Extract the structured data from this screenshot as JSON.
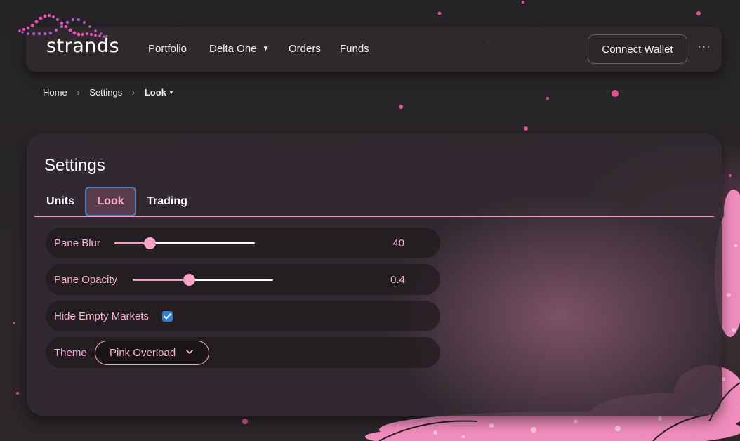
{
  "brand": {
    "name": "strands"
  },
  "nav": {
    "items": [
      {
        "label": "Portfolio",
        "dropdown": false
      },
      {
        "label": "Delta One",
        "dropdown": true
      },
      {
        "label": "Orders",
        "dropdown": false
      },
      {
        "label": "Funds",
        "dropdown": false
      }
    ],
    "connect_wallet_label": "Connect Wallet",
    "more_icon": "ellipsis-icon",
    "more_glyph": "···"
  },
  "breadcrumb": {
    "items": [
      "Home",
      "Settings",
      "Look"
    ],
    "separator": "›",
    "current_caret": "▾"
  },
  "settings": {
    "title": "Settings",
    "tabs": [
      {
        "label": "Units",
        "active": false
      },
      {
        "label": "Look",
        "active": true
      },
      {
        "label": "Trading",
        "active": false
      }
    ],
    "pane_blur": {
      "label": "Pane Blur",
      "value": "40",
      "fraction": 0.25
    },
    "pane_opacity": {
      "label": "Pane Opacity",
      "value": "0.4",
      "fraction": 0.4
    },
    "hide_empty_markets": {
      "label": "Hide Empty Markets",
      "checked": true
    },
    "theme": {
      "label": "Theme",
      "selected": "Pink Overload"
    }
  },
  "colors": {
    "accent_pink": "#f7a4c6",
    "checkbox_blue": "#2f7dd6",
    "tab_focus_border": "#4a7fb8"
  }
}
